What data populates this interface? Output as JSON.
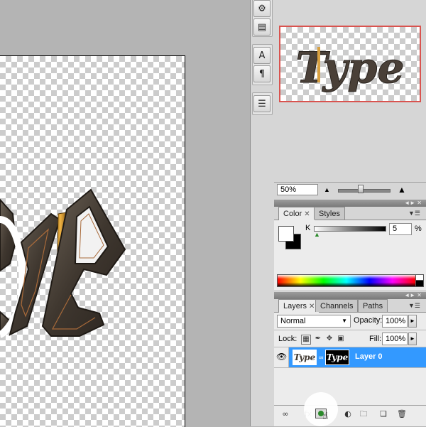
{
  "navigator": {
    "zoom_value": "50%"
  },
  "color_panel": {
    "tabs": [
      "Color",
      "Styles"
    ],
    "channel_label": "K",
    "k_value": "5",
    "percent_sign": "%"
  },
  "layers_panel": {
    "tabs": [
      "Layers",
      "Channels",
      "Paths"
    ],
    "blend_mode": "Normal",
    "opacity_label": "Opacity:",
    "opacity_value": "100%",
    "lock_label": "Lock:",
    "fill_label": "Fill:",
    "fill_value": "100%",
    "layers": [
      {
        "name": "Layer 0",
        "thumb_text": "Type",
        "mask_text": "Type",
        "visible": true,
        "selected": true
      }
    ]
  },
  "artwork": {
    "text": "Type"
  },
  "colors": {
    "selection": "#3399ff",
    "highlight_frame": "#d9534f"
  }
}
